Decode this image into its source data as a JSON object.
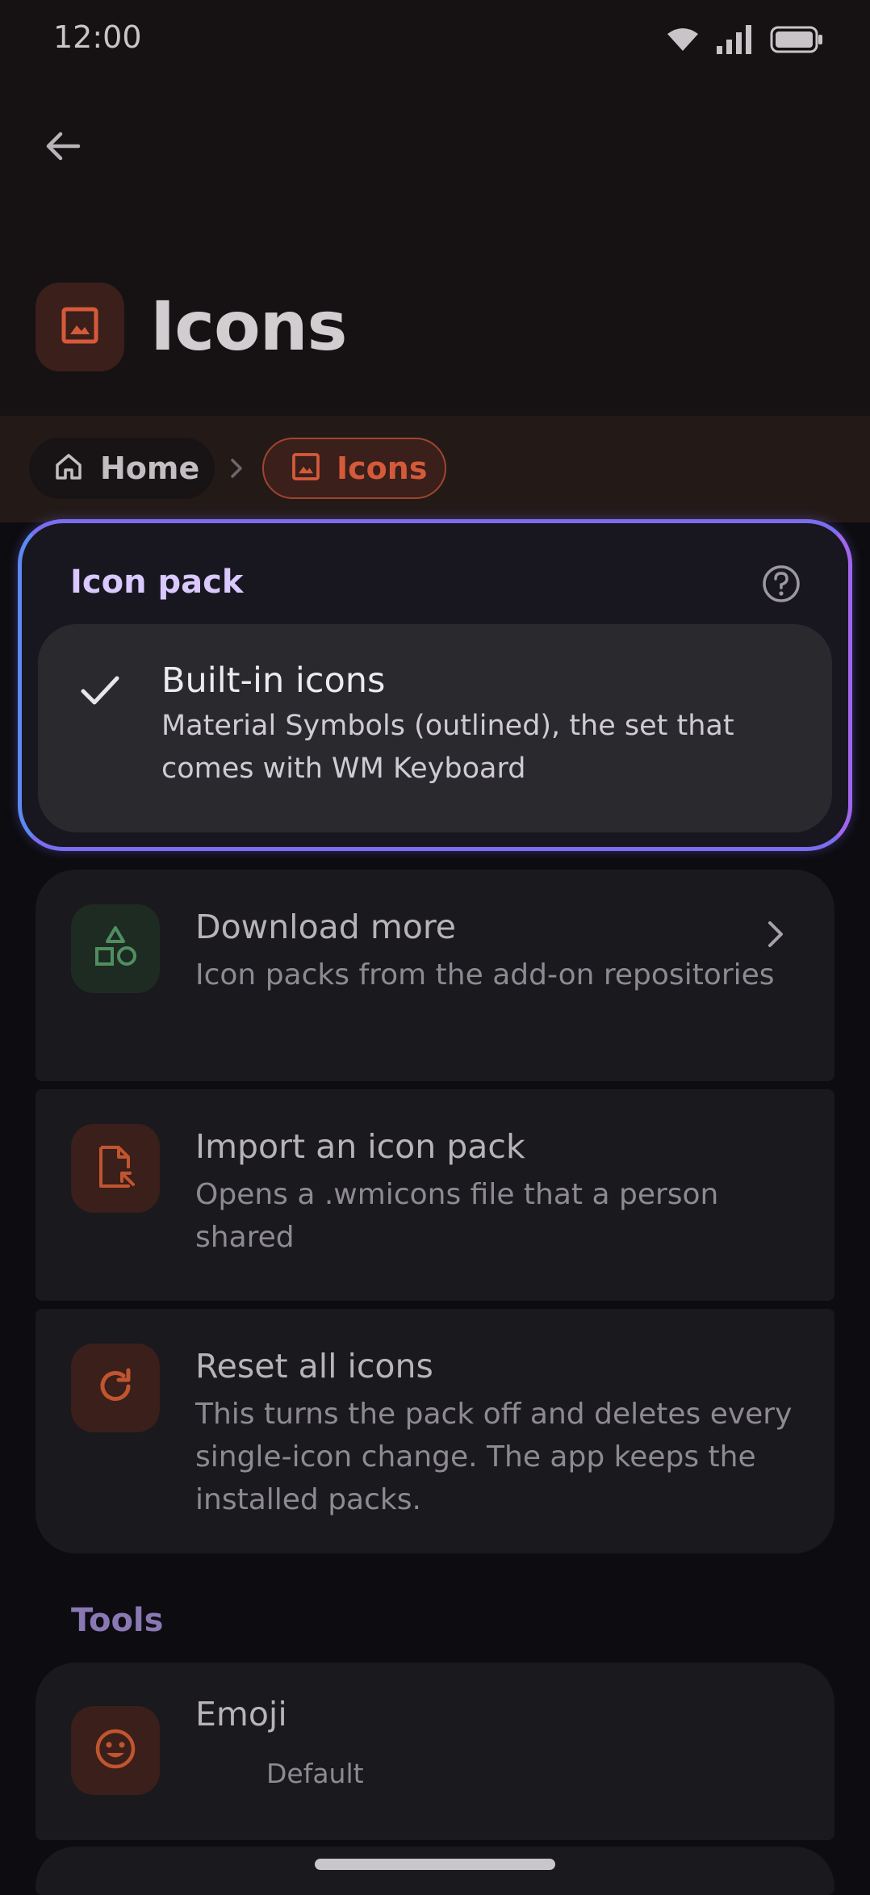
{
  "status_bar": {
    "time": "12:00",
    "icons": [
      "wifi-icon",
      "signal-icon",
      "battery-icon"
    ]
  },
  "header": {
    "back_icon": "arrow-back-icon",
    "title": "Icons",
    "title_icon": "image-icon"
  },
  "breadcrumb": [
    {
      "label": "Home",
      "icon": "home-icon"
    },
    {
      "label": "Icons",
      "icon": "image-icon",
      "active": true
    }
  ],
  "icon_pack": {
    "title": "Icon pack",
    "help_icon": "help-circle-icon",
    "selected": {
      "title": "Built-in icons",
      "description": "Material Symbols (outlined), the set that comes with WM Keyboard"
    }
  },
  "actions": [
    {
      "title": "Download more",
      "description": "Icon packs from the add-on repositories",
      "icon": "shapes-icon"
    },
    {
      "title": "Import an icon pack",
      "description": "Opens a .wmicons file that a person shared",
      "icon": "file-import-icon"
    },
    {
      "title": "Reset all icons",
      "description": "This turns the pack off and deletes every single-icon change. The app keeps the installed packs.",
      "icon": "reset-icon"
    }
  ],
  "tools": {
    "title": "Tools",
    "items": [
      {
        "title": "Emoji",
        "subtitle": "Default",
        "icon": "emoji-icon"
      }
    ]
  },
  "colors": {
    "accent": "#d45a3a",
    "focus_ring": "#7a6ef0",
    "background": "#0d0c10"
  }
}
